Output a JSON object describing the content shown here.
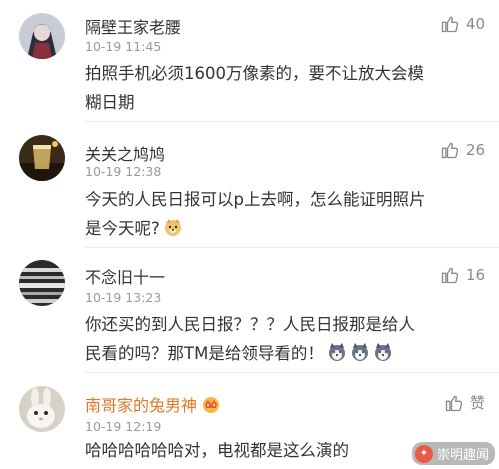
{
  "comments": [
    {
      "username": "隔壁王家老腰",
      "time": "10-19 11:45",
      "likes": "40",
      "text_lines": [
        "拍照手机必须1600万像素的，要不让放大会模",
        "糊日期"
      ],
      "avatar_icon": "anime-figure-avatar"
    },
    {
      "username": "关关之鸠鸠",
      "time": "10-19 12:38",
      "likes": "26",
      "text_lines": [
        "今天的人民日报可以p上去啊，怎么能证明照片",
        "是今天呢?"
      ],
      "emoji_icons": [
        "doge-emoji"
      ],
      "avatar_icon": "glass-avatar"
    },
    {
      "username": "不念旧十一",
      "time": "10-19 13:23",
      "likes": "16",
      "text_lines": [
        "你还买的到人民日报？？？人民日报那是给人",
        "民看的吗？那TM是给领导看的！"
      ],
      "emoji_icons": [
        "husky-emoji",
        "husky-emoji",
        "husky-emoji"
      ],
      "avatar_icon": "stripes-avatar"
    },
    {
      "username": "南哥家的兔男神",
      "time": "10-19 12:19",
      "likes": "赞",
      "text_lines": [
        "哈哈哈哈哈哈对，电视都是这么演的"
      ],
      "avatar_icon": "rabbit-avatar"
    }
  ],
  "watermark": {
    "text": "崇明趣闻"
  },
  "colors": {
    "username": "#333333",
    "vip_username": "#e0782a",
    "time": "#9a9a9a",
    "like": "#8a8a8a",
    "divider": "#ececec"
  }
}
